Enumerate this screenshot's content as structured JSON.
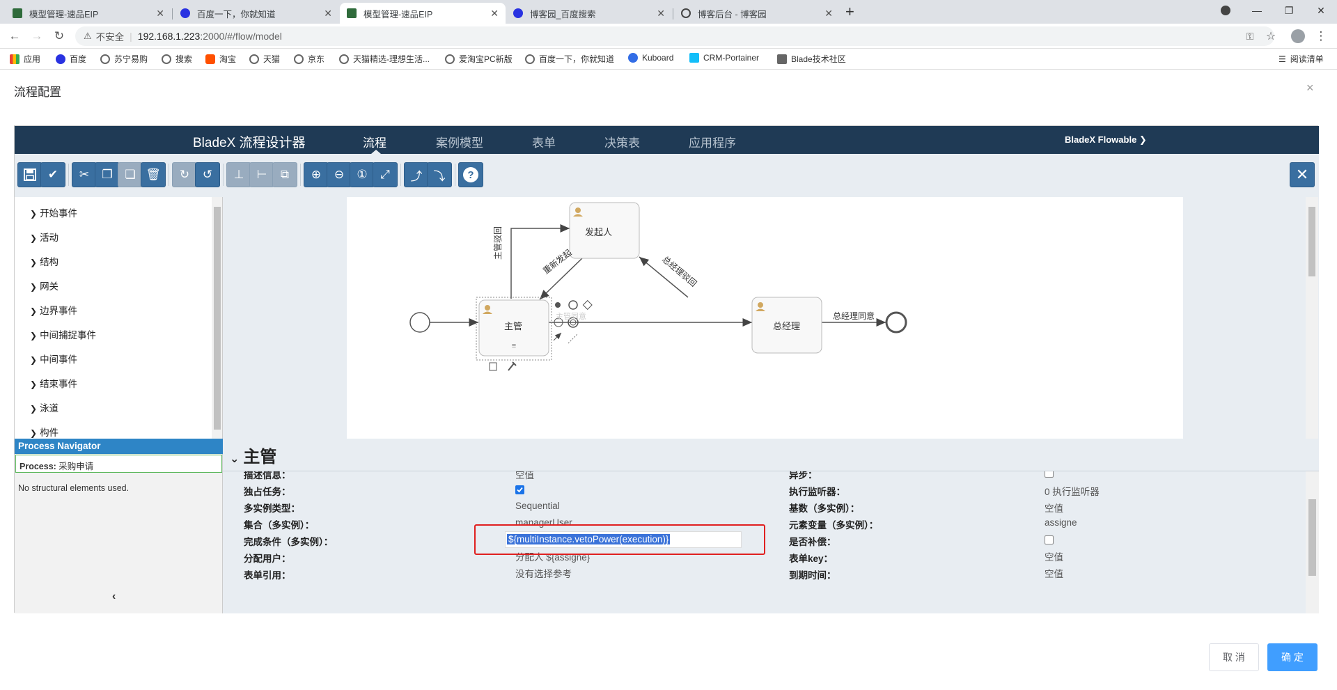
{
  "browser": {
    "tabs": [
      {
        "label": "模型管理-速品EIP",
        "active": false
      },
      {
        "label": "百度一下，你就知道",
        "active": false
      },
      {
        "label": "模型管理-速品EIP",
        "active": true
      },
      {
        "label": "博客园_百度搜索",
        "active": false
      },
      {
        "label": "博客后台 - 博客园",
        "active": false
      }
    ],
    "new_tab": "+",
    "address": {
      "security": "不安全",
      "url_host": "192.168.1.223",
      "url_rest": ":2000/#/flow/model"
    },
    "bookmarks": [
      "应用",
      "百度",
      "苏宁易购",
      "搜索",
      "淘宝",
      "天猫",
      "京东",
      "天猫精选-理想生活...",
      "爱淘宝PC新版",
      "百度一下，你就知道",
      "Kuboard",
      "CRM-Portainer",
      "Blade技术社区"
    ],
    "reading_list": "阅读清单"
  },
  "dialog": {
    "title": "流程配置",
    "close": "×",
    "cancel_label": "取 消",
    "ok_label": "确 定"
  },
  "designer": {
    "brand": "BladeX 流程设计器",
    "menus": [
      "流程",
      "案例模型",
      "表单",
      "决策表",
      "应用程序"
    ],
    "user_menu": "BladeX Flowable ❯"
  },
  "palette": {
    "items": [
      "开始事件",
      "活动",
      "结构",
      "网关",
      "边界事件",
      "中间捕捉事件",
      "中间事件",
      "结束事件",
      "泳道",
      "构件"
    ]
  },
  "diagram": {
    "nodes": {
      "initiator": "发起人",
      "supervisor": "主管",
      "manager": "总经理"
    },
    "flows": {
      "supervisor_reject": "主管驳回",
      "resubmit": "重新发起",
      "manager_reject": "总经理驳回",
      "manager_agree": "总经理同意",
      "faded": "主管同意"
    }
  },
  "navigator": {
    "header": "Process Navigator",
    "process_label": "Process:",
    "process_value": "采购申请",
    "note": "No structural elements used.",
    "collapse": "‹"
  },
  "properties": {
    "title": "主管",
    "rows": {
      "r0l": {
        "label": "描述信息：",
        "value": "空值"
      },
      "r0r": {
        "label": "异步：",
        "checkbox": false
      },
      "r1l": {
        "label": "独占任务：",
        "checkbox": true
      },
      "r1r": {
        "label": "执行监听器：",
        "value": "0 执行监听器"
      },
      "r2l": {
        "label": "多实例类型：",
        "value": "Sequential"
      },
      "r2r": {
        "label": "基数（多实例）：",
        "value": "空值"
      },
      "r3l": {
        "label": "集合（多实例）：",
        "value": "managerUser"
      },
      "r3r": {
        "label": "元素变量（多实例）：",
        "value": "assigne"
      },
      "r4l": {
        "label": "完成条件（多实例）：",
        "value": "${multiInstance.vetoPower(execution)}"
      },
      "r4r": {
        "label": "是否补偿：",
        "checkbox": false
      },
      "r5l": {
        "label": "分配用户：",
        "value": "分配人 ${assigne}"
      },
      "r5r": {
        "label": "表单key：",
        "value": "空值"
      },
      "r6l": {
        "label": "表单引用：",
        "value": "没有选择参考"
      },
      "r6r": {
        "label": "到期时间：",
        "value": "空值"
      }
    }
  },
  "colors": {
    "header": "#1f3a55",
    "toolbar_button": "#3a6fa0",
    "highlight_box": "#e02020",
    "primary": "#409eff"
  }
}
